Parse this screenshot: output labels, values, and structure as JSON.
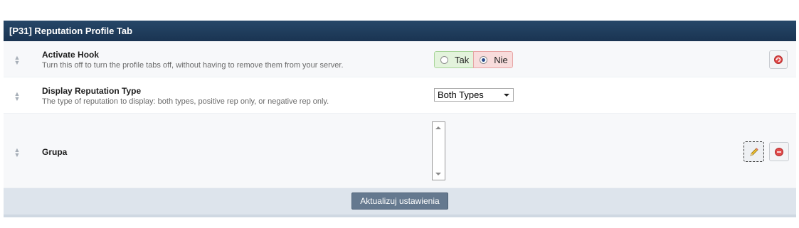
{
  "panel": {
    "title": "[P31] Reputation Profile Tab"
  },
  "settings": [
    {
      "title": "Activate Hook",
      "description": "Turn this off to turn the profile tabs off, without having to remove them from your server.",
      "control": "yes-no",
      "yes_label": "Tak",
      "no_label": "Nie",
      "selected": "Nie",
      "action_icon": "revert-icon"
    },
    {
      "title": "Display Reputation Type",
      "description": "The type of reputation to display: both types, positive rep only, or negative rep only.",
      "control": "select",
      "selected": "Both Types"
    },
    {
      "title": "Grupa",
      "description": "",
      "control": "multiselect",
      "action_icons": [
        "edit-icon",
        "delete-icon"
      ]
    }
  ],
  "footer": {
    "submit_label": "Aktualizuj ustawienia"
  },
  "colors": {
    "header_bg": "#1d3a59",
    "yes_bg": "#e3f3dc",
    "no_bg": "#f8dcdc",
    "submit_bg": "#65798f",
    "footer_bg": "#dde4ec"
  }
}
